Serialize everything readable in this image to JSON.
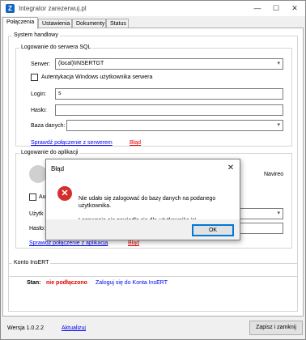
{
  "window": {
    "logo_letter": "Z",
    "title": "Integrator zarezerwuj.pl",
    "minimize": "—",
    "maximize": "☐",
    "close": "✕"
  },
  "tabs": [
    "Połączenia",
    "Ustawienia",
    "Dokumenty",
    "Status"
  ],
  "system": {
    "group_label": "System handlowy",
    "sql": {
      "group_label": "Logowanie do serwera SQL",
      "server_label": "Serwer:",
      "server_value": "(local)\\INSERTGT",
      "windows_auth_label": "Autentykacja Windows użytkownika serwera",
      "login_label": "Login:",
      "login_value": "s",
      "password_label": "Hasło:",
      "password_value": "",
      "database_label": "Baza danych:",
      "database_value": "",
      "check_link": "Sprawdź połączenie z serwerem",
      "check_status": "Błąd"
    },
    "app": {
      "group_label": "Logowanie do aplikacji",
      "product_partial": "Navireo",
      "auth_partial": "Au",
      "user_partial": "Użytk",
      "password_partial": "Hasło:",
      "check_link_partial": "Sprawdź połączenie z aplikacją",
      "check_status_partial": "Błąd"
    }
  },
  "konto": {
    "group_label": "Konto InsERT",
    "status_label": "Stan:",
    "status_value": "nie podłączono",
    "connect_link": "Zaloguj się do Konta InsERT"
  },
  "footer": {
    "version_label": "Wersja 1.0.2.2",
    "update_link": "Aktualizuj",
    "save_close": "Zapisz i zamknij"
  },
  "dialog": {
    "title": "Błąd",
    "close": "✕",
    "icon": "error-icon",
    "message_line1": "Nie udało się zalogować do bazy danych na podanego użytkownika.",
    "message_line2": "Logowanie nie powiodło się dla użytkownika 's'.",
    "ok": "OK"
  },
  "colors": {
    "accent": "#0078d7",
    "error": "#e00000",
    "link": "#0000ee",
    "logo": "#1565c0"
  }
}
